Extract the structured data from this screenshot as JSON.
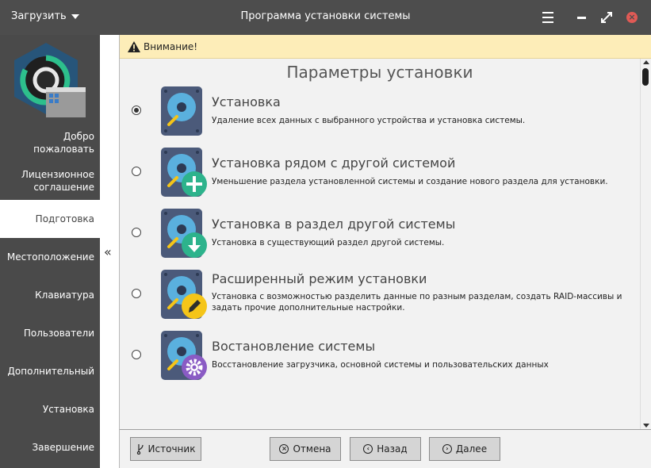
{
  "window": {
    "title": "Программа установки системы",
    "menu_label": "Загрузить"
  },
  "icons": {
    "menu": "hamburger-icon",
    "minimize": "minimize-icon",
    "maximize": "maximize-icon",
    "close": "close-icon",
    "warning": "warning-icon",
    "collapse": "double-chevron-left-icon"
  },
  "sidebar": {
    "items": [
      {
        "label": "Добро пожаловать",
        "active": false
      },
      {
        "label": "Лицензионное соглашение",
        "active": false
      },
      {
        "label": "Подготовка",
        "active": true
      },
      {
        "label": "Местоположение",
        "active": false
      },
      {
        "label": "Клавиатура",
        "active": false
      },
      {
        "label": "Пользователи",
        "active": false
      },
      {
        "label": "Дополнительный",
        "active": false
      },
      {
        "label": "Установка",
        "active": false
      },
      {
        "label": "Завершение",
        "active": false
      }
    ]
  },
  "warning": {
    "text": "Внимание!"
  },
  "main": {
    "title": "Параметры установки",
    "options": [
      {
        "title": "Установка",
        "description": "Удаление всех данных с выбранного устройства и установка системы.",
        "selected": true,
        "badge": "none"
      },
      {
        "title": "Установка рядом с другой системой",
        "description": "Уменьшение раздела установленной системы и создание нового раздела для установки.",
        "selected": false,
        "badge": "plus"
      },
      {
        "title": "Установка в раздел другой системы",
        "description": "Установка в существующий раздел другой системы.",
        "selected": false,
        "badge": "download"
      },
      {
        "title": "Расширенный режим установки",
        "description": "Установка с возможностью разделить данные по разным разделам, создать RAID-массивы и задать прочие дополнительные настройки.",
        "selected": false,
        "badge": "pencil"
      },
      {
        "title": "Востановление системы",
        "description": "Восстановление загрузчика, основной системы и пользовательских данных",
        "selected": false,
        "badge": "gear"
      }
    ]
  },
  "footer": {
    "source_label": "Источник",
    "cancel_label": "Отмена",
    "back_label": "Назад",
    "next_label": "Далее"
  },
  "colors": {
    "titlebar": "#4d4d4d",
    "sidebar": "#4a4a4a",
    "warning_bg": "#fdedb8",
    "disk_body": "#4b5a7a",
    "disk_platter": "#5ab0de",
    "badge_plus": "#2db38c",
    "badge_download": "#2db38c",
    "badge_pencil": "#f5c518",
    "badge_gear": "#8a5bc4"
  }
}
